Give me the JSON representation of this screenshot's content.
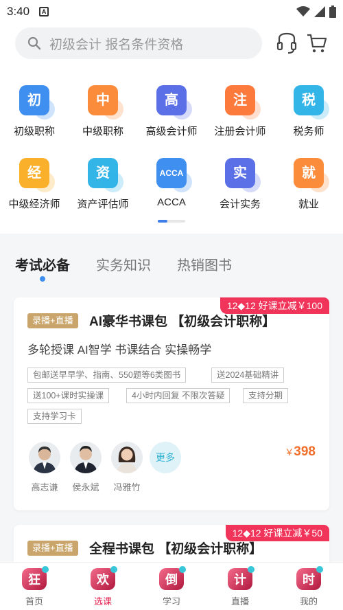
{
  "status": {
    "time": "3:40",
    "notif_glyph": "A"
  },
  "search": {
    "placeholder": "初级会计 报名条件资格"
  },
  "categories": [
    {
      "glyph": "初",
      "label": "初级职称",
      "color": "#3f8ff0"
    },
    {
      "glyph": "中",
      "label": "中级职称",
      "color": "#fb8c3c"
    },
    {
      "glyph": "高",
      "label": "高级会计师",
      "color": "#5b6fe6"
    },
    {
      "glyph": "注",
      "label": "注册会计师",
      "color": "#fb7a3c"
    },
    {
      "glyph": "税",
      "label": "税务师",
      "color": "#33b5e8"
    },
    {
      "glyph": "经",
      "label": "中级经济师",
      "color": "#fbb02c"
    },
    {
      "glyph": "资",
      "label": "资产评估师",
      "color": "#33b5e8"
    },
    {
      "glyph": "ACCA",
      "label": "ACCA",
      "color": "#3f8ff0"
    },
    {
      "glyph": "实",
      "label": "会计实务",
      "color": "#5b6fe6"
    },
    {
      "glyph": "就",
      "label": "就业",
      "color": "#fb8c3c"
    }
  ],
  "tabs": [
    {
      "label": "考试必备",
      "active": true
    },
    {
      "label": "实务知识",
      "active": false
    },
    {
      "label": "热销图书",
      "active": false
    }
  ],
  "cards": [
    {
      "promo": "12◆12 好课立减￥100",
      "badge": "录播+直播",
      "title": "AI豪华书课包 【初级会计职称】",
      "subtitle": "多轮授课 AI智学 书课结合 实操畅学",
      "tags": [
        "包邮送早早学、指南、550题等6类图书",
        "送2024基础精讲",
        "送100+课时实操课",
        "4小时内回复 不限次答疑",
        "支持分期",
        "支持学习卡"
      ],
      "teachers": [
        "高志谦",
        "侯永斌",
        "冯雅竹"
      ],
      "more": "更多",
      "currency": "￥",
      "price": "398"
    },
    {
      "promo": "12◆12 好课立减￥50",
      "badge": "录播+直播",
      "title": "全程书课包 【初级会计职称】"
    }
  ],
  "bottom_nav": [
    {
      "glyph": "狂",
      "label": "首页",
      "active": false
    },
    {
      "glyph": "欢",
      "label": "选课",
      "active": true
    },
    {
      "glyph": "倒",
      "label": "学习",
      "active": false
    },
    {
      "glyph": "计",
      "label": "直播",
      "active": false
    },
    {
      "glyph": "时",
      "label": "我的",
      "active": false
    }
  ],
  "colors": {
    "accent": "#3f8ff0",
    "promo": "#f0345a",
    "price": "#f26e2b",
    "nav_active": "#e4214f"
  }
}
